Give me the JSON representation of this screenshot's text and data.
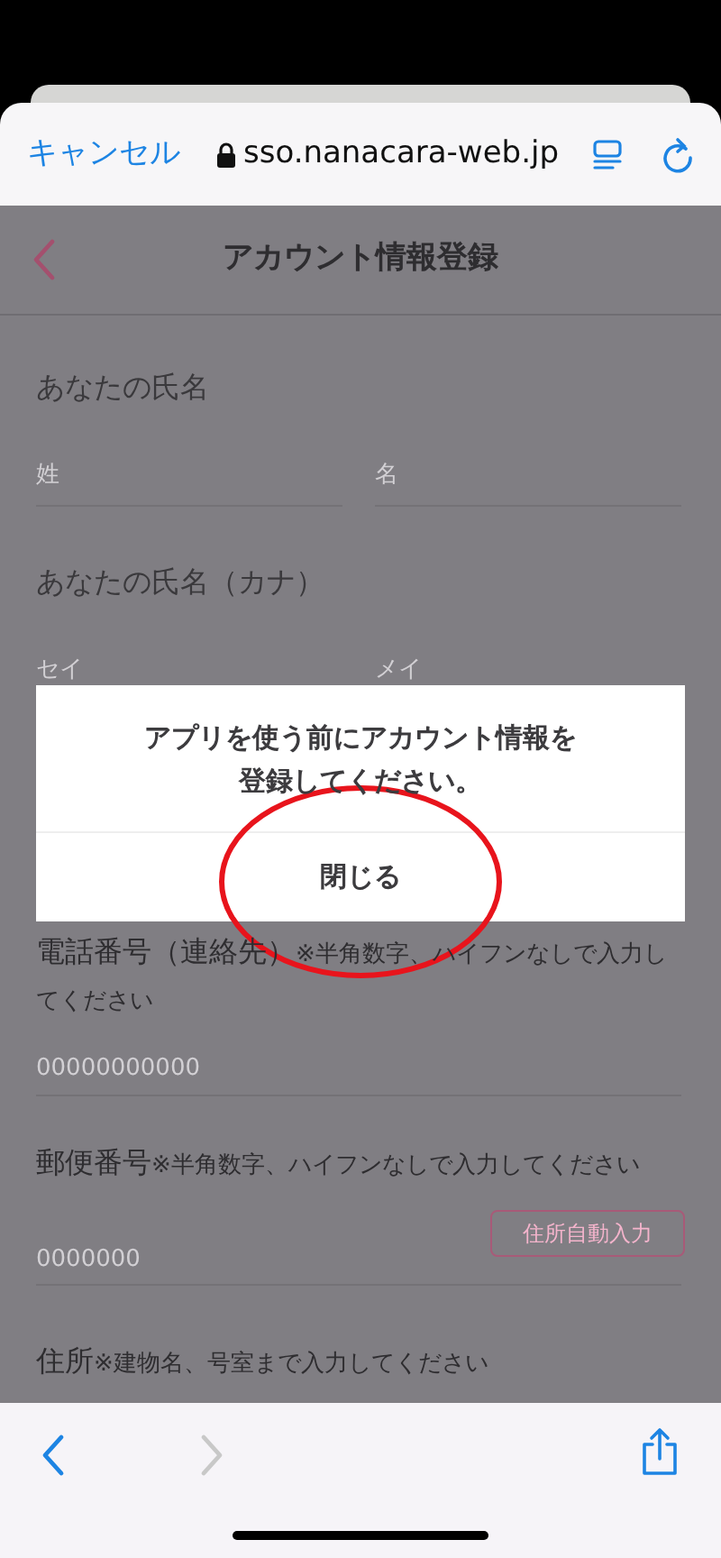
{
  "browser_bar": {
    "cancel": "キャンセル",
    "url": "sso.nanacara-web.jp"
  },
  "header": {
    "title": "アカウント情報登録"
  },
  "form": {
    "name_label": "あなたの氏名",
    "name_fields": [
      {
        "placeholder": "姓"
      },
      {
        "placeholder": "名"
      }
    ],
    "kana_label": "あなたの氏名（カナ）",
    "kana_fields": [
      {
        "placeholder": "セイ"
      },
      {
        "placeholder": "メイ"
      }
    ],
    "phone_label": "電話番号（連絡先）",
    "phone_note": "※半角数字、ハイフンなしで入力してください",
    "phone_placeholder": "00000000000",
    "postal_label": "郵便番号",
    "postal_note": "※半角数字、ハイフンなしで入力してください",
    "postal_placeholder": "0000000",
    "postal_button": "住所自動入力",
    "address_label": "住所",
    "address_note": "※建物名、号室まで入力してください"
  },
  "dialog": {
    "message_lines": [
      "アプリを使う前にアカウント情報を",
      "登録してください。"
    ],
    "button": "閉じる"
  },
  "annotation": {
    "ellipse": true
  },
  "toolbar": {
    "back_disabled": false,
    "forward_disabled": true
  }
}
